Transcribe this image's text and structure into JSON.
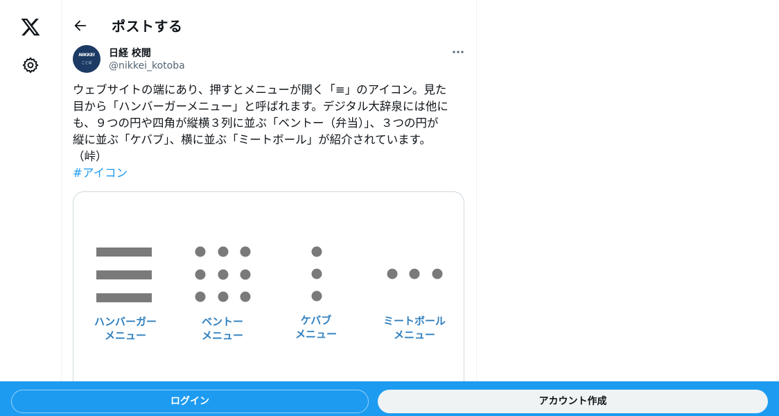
{
  "header": {
    "title": "ポストする"
  },
  "author": {
    "name": "日経 校閲",
    "handle": "@nikkei_kotoba",
    "avatar_text": "NIKKEI",
    "avatar_subtext": "ことば"
  },
  "post": {
    "lines": [
      "ウェブサイトの端にあり、押すとメニューが開く「≡」のアイコン。見た",
      "目から「ハンバーガーメニュー」と呼ばれます。デジタル大辞泉には他に",
      "も、９つの円や四角が縦横３列に並ぶ「ベントー（弁当）」、３つの円が",
      "縦に並ぶ「ケバブ」、横に並ぶ「ミートボール」が紹介されています。",
      "（峠）"
    ],
    "hashtag": "#アイコン"
  },
  "card": {
    "menus": [
      {
        "line1": "ハンバーガー",
        "line2": "メニュー"
      },
      {
        "line1": "ベントー",
        "line2": "メニュー"
      },
      {
        "line1": "ケバブ",
        "line2": "メニュー"
      },
      {
        "line1": "ミートボール",
        "line2": "メニュー"
      }
    ]
  },
  "bottom_bar": {
    "login_label": "ログイン",
    "signup_label": "アカウント作成"
  },
  "colors": {
    "accent": "#1d9bf0",
    "card_label": "#2f7fbf",
    "icon_gray": "#7a7a7a"
  },
  "icons": [
    "x-logo-icon",
    "gear-icon",
    "back-arrow-icon",
    "more-icon"
  ]
}
